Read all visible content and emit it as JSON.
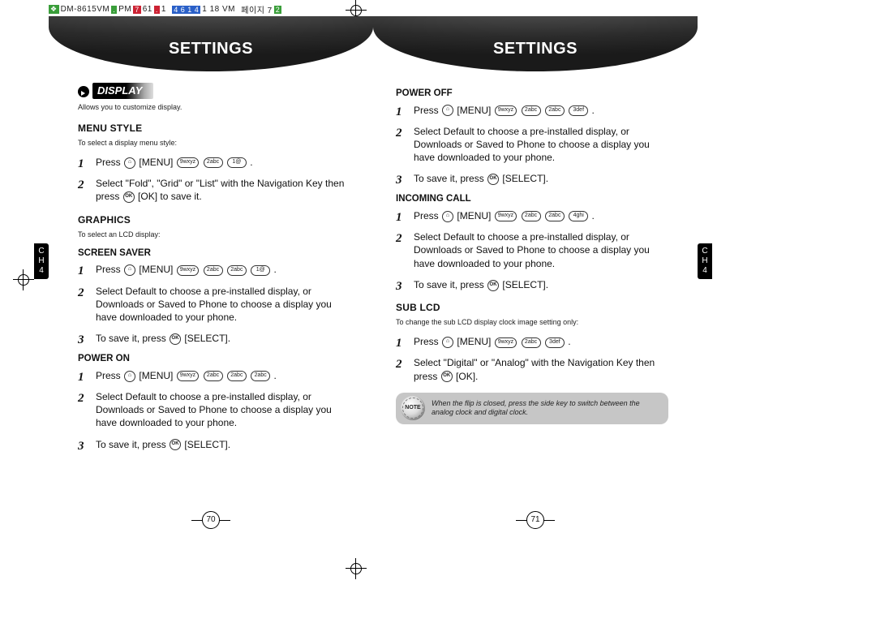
{
  "header_strip": {
    "text_left": "DM-8615VM",
    "text_mid": "PM",
    "text_date": "61",
    "text_mid2": "1",
    "text_blue": "4  6 1 4",
    "text_time": "1  18 VM",
    "text_right_label": "페이지 7",
    "text_right_num": "2"
  },
  "banner_title": "SETTINGS",
  "display_label": "DISPLAY",
  "display_desc": "Allows you to customize display.",
  "ch_label_c": "C",
  "ch_label_h": "H",
  "ch_label_n": "4",
  "page_left_num": "70",
  "page_right_num": "71",
  "left": {
    "menu_style_title": "MENU STYLE",
    "menu_style_desc": "To select a display menu style:",
    "menu_style_steps": [
      "Press ⌂ [MENU] ⬭ ⬭ ⬭ .",
      "Select \"Fold\", \"Grid\" or \"List\" with the Navigation Key then press ⊙ [OK] to save it."
    ],
    "graphics_title": "GRAPHICS",
    "graphics_desc": "To select an LCD display:",
    "screen_saver_title": "SCREEN SAVER",
    "screen_saver_steps": [
      "Press ⌂ [MENU] ⬭ ⬭ ⬭ ⬭ .",
      "Select Default to choose a pre-installed display, or Downloads or Saved to Phone to choose a display you have downloaded to your phone.",
      "To save it, press ⊙ [SELECT]."
    ],
    "power_on_title": "POWER ON",
    "power_on_steps": [
      "Press ⌂ [MENU] ⬭ ⬭ ⬭ ⬭ .",
      "Select Default to choose a pre-installed display, or Downloads or Saved to Phone to choose a display you have downloaded to your phone.",
      "To save it, press ⊙ [SELECT]."
    ]
  },
  "right": {
    "power_off_title": "POWER OFF",
    "power_off_steps": [
      "Press ⌂ [MENU] ⬭ ⬭ ⬭ ⬭ .",
      "Select Default to choose a pre-installed display, or Downloads or Saved to Phone to choose a display you have downloaded to your phone.",
      "To save it, press ⊙ [SELECT]."
    ],
    "incoming_call_title": "INCOMING CALL",
    "incoming_call_steps": [
      "Press ⌂ [MENU] ⬭ ⬭ ⬭ ⬭ .",
      "Select Default to choose a pre-installed display, or Downloads or Saved to Phone to choose a display you have downloaded to your phone.",
      "To save it, press ⊙ [SELECT]."
    ],
    "sub_lcd_title": "SUB LCD",
    "sub_lcd_desc": "To change the sub LCD display clock image setting only:",
    "sub_lcd_steps": [
      "Press ⌂ [MENU] ⬭ ⬭ ⬭ .",
      "Select \"Digital\" or \"Analog\" with the Navigation Key then press ⊙ [OK]."
    ],
    "note_label": "NOTE",
    "note_text": "When the flip is closed, press the side key to switch between the analog clock and digital clock."
  },
  "keys": {
    "menu_press_prefix": "Press",
    "menu_label": "[MENU]",
    "ok_label": "[OK]",
    "select_label": "[SELECT].",
    "ok_key": "OK",
    "k9": "9wxyz",
    "k2": "2abc",
    "k3": "3def",
    "k4": "4ghi",
    "k1": "1@"
  }
}
